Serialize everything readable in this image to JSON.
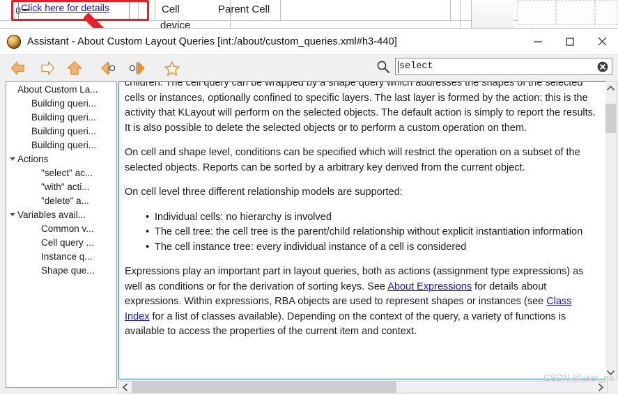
{
  "background": {
    "row_number": "0",
    "details_link": "Click here for details",
    "table_headers": [
      "Cell",
      "Parent Cell"
    ],
    "first_cell_value": "device"
  },
  "annotation": {
    "highlight_color": "#ee1c25",
    "arrow_name": "red-callout-arrow"
  },
  "window": {
    "title": "Assistant - About Custom Layout Queries [int:/about/custom_queries.xml#h3-440]",
    "icon_name": "klayout-app-icon",
    "controls": {
      "minimize": "—",
      "maximize": "□",
      "close": "✕"
    }
  },
  "toolbar": {
    "buttons": [
      {
        "name": "back-arrow-icon",
        "label": "Back"
      },
      {
        "name": "forward-arrow-icon",
        "label": "Forward"
      },
      {
        "name": "home-arrow-icon",
        "label": "Home"
      },
      {
        "name": "previous-topic-icon",
        "label": "Previous topic"
      },
      {
        "name": "next-topic-icon",
        "label": "Next topic"
      },
      {
        "name": "bookmark-star-icon",
        "label": "Add bookmark"
      }
    ],
    "search": {
      "icon_name": "search-magnifier-icon",
      "value": "select",
      "placeholder": "",
      "clear_icon_name": "clear-circle-icon"
    }
  },
  "sidebar": {
    "items": [
      {
        "label": "About Custom La...",
        "indent": 0,
        "expander": "none",
        "selected": false
      },
      {
        "label": "Building queri...",
        "indent": 1,
        "expander": "none",
        "selected": false
      },
      {
        "label": "Building queri...",
        "indent": 1,
        "expander": "none",
        "selected": false
      },
      {
        "label": "Building queri...",
        "indent": 1,
        "expander": "none",
        "selected": false
      },
      {
        "label": "Building queri...",
        "indent": 1,
        "expander": "none",
        "selected": false
      },
      {
        "label": "Actions",
        "indent": 0,
        "expander": "open",
        "selected": false
      },
      {
        "label": "\"select\" ac...",
        "indent": 2,
        "expander": "none",
        "selected": false
      },
      {
        "label": "\"with\" acti...",
        "indent": 2,
        "expander": "none",
        "selected": false
      },
      {
        "label": "\"delete\" a...",
        "indent": 2,
        "expander": "none",
        "selected": false
      },
      {
        "label": "Variables avail...",
        "indent": 0,
        "expander": "open",
        "selected": false
      },
      {
        "label": "Common v...",
        "indent": 2,
        "expander": "none",
        "selected": false
      },
      {
        "label": "Cell query ...",
        "indent": 2,
        "expander": "none",
        "selected": false
      },
      {
        "label": "Instance q...",
        "indent": 2,
        "expander": "none",
        "selected": false
      },
      {
        "label": "Shape que...",
        "indent": 2,
        "expander": "none",
        "selected": false
      }
    ]
  },
  "content": {
    "paragraph_clipped": "children. The cell query can be wrapped by a shape query which addresses the shapes of the selected cells or instances, optionally confined to specific layers. The last layer is formed by the action: this is the activity that KLayout will perform on the selected objects. The default action is simply to report the results. It is also possible to delete the selected objects or to perform a custom operation on them.",
    "paragraph_2": "On cell and shape level, conditions can be specified which will restrict the operation on a subset of the selected objects. Reports can be sorted by a arbitrary key derived from the current object.",
    "paragraph_3": "On cell level three different relationship models are supported:",
    "bullets": [
      "Individual cells: no hierarchy is involved",
      "The cell tree: the cell tree is the parent/child relationship without explicit instantiation information",
      "The cell instance tree: every individual instance of a cell is considered"
    ],
    "paragraph_4_part1": "Expressions play an important part in layout queries, both as actions (assignment type expressions) as well as conditions or for the derivation of sorting keys. See ",
    "link_about_expressions": "About Expressions",
    "paragraph_4_part2": " for details about expressions. Within expressions, RBA objects are used to represent shapes or instances (see ",
    "link_class_index": "Class Index",
    "paragraph_4_part3": " for a list of classes available). Depending on the context of the query, a variety of functions is available to access the properties of the current item and context."
  },
  "scrollbars": {
    "vertical_up_icon": "chevron-up-icon",
    "vertical_down_icon": "chevron-down-icon",
    "horizontal_left_icon": "chevron-left-icon",
    "horizontal_right_icon": "chevron-right-icon"
  },
  "watermark": {
    "text": "CSDN @user_na"
  },
  "colors": {
    "link": "#1414c8",
    "focus_border": "#1e74c8",
    "annotation_red": "#ee1c25",
    "toolbar_icon_orange": "#f0922b",
    "window_chrome": "#f0f0f0"
  }
}
